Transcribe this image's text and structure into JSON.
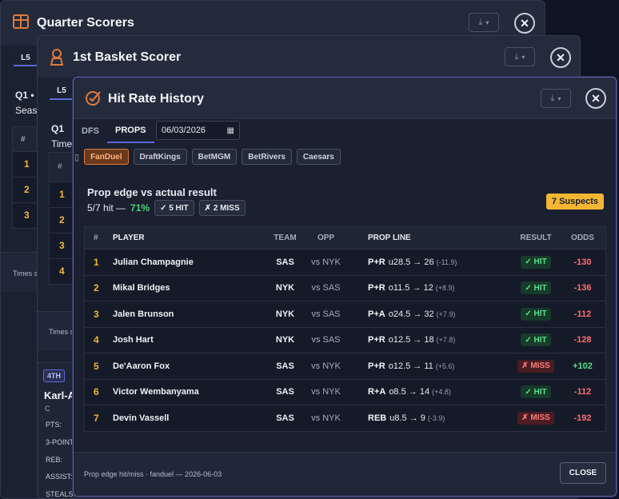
{
  "quarter_window": {
    "title": "Quarter Scorers",
    "tab": "L5",
    "heading": "Q1 •",
    "sub": "Seaso",
    "col_hash": "#",
    "rows": [
      "1",
      "2",
      "3"
    ],
    "footer": "Times s"
  },
  "basket_window": {
    "title": "1st Basket Scorer",
    "tab": "L5",
    "heading": "Q1",
    "sub": "Times",
    "col_hash": "#",
    "rows": [
      "1",
      "2",
      "3",
      "4"
    ],
    "footer": "Times s",
    "card_badge": "4TH",
    "card_name": "Karl-A",
    "card_pos": "C",
    "card_stats": [
      "PTS:",
      "3-POINT",
      "REB:",
      "ASSIST:",
      "STEALS:"
    ]
  },
  "dialog": {
    "title": "Hit Rate History",
    "tabs": [
      {
        "label": "DFS",
        "active": false
      },
      {
        "label": "PROPS",
        "active": true
      }
    ],
    "date_value": "06/03/2026",
    "books": [
      {
        "label": "FanDuel",
        "active": true
      },
      {
        "label": "DraftKings",
        "active": false
      },
      {
        "label": "BetMGM",
        "active": false
      },
      {
        "label": "BetRivers",
        "active": false
      },
      {
        "label": "Caesars",
        "active": false
      }
    ],
    "summary": {
      "title": "Prop edge vs actual result",
      "hit_text": "5/7 hit —",
      "pct": "71%",
      "hit_chip": "✓ 5 HIT",
      "miss_chip": "✗ 2 MISS",
      "suspects": "7 Suspects"
    },
    "columns": {
      "num": "#",
      "player": "PLAYER",
      "team": "TEAM",
      "opp": "OPP",
      "line": "PROP LINE",
      "result": "RESULT",
      "odds": "ODDS"
    },
    "rows": [
      {
        "num": "1",
        "player": "Julian Champagnie",
        "team": "SAS",
        "opp": "vs NYK",
        "type": "P+R",
        "line": "u28.5 → 26",
        "edge": "(-11.9)",
        "result": "✓ HIT",
        "hit": true,
        "odds": "-130",
        "odds_pos": false
      },
      {
        "num": "2",
        "player": "Mikal Bridges",
        "team": "NYK",
        "opp": "vs SAS",
        "type": "P+R",
        "line": "o11.5 → 12",
        "edge": "(+8.9)",
        "result": "✓ HIT",
        "hit": true,
        "odds": "-136",
        "odds_pos": false
      },
      {
        "num": "3",
        "player": "Jalen Brunson",
        "team": "NYK",
        "opp": "vs SAS",
        "type": "P+A",
        "line": "o24.5 → 32",
        "edge": "(+7.9)",
        "result": "✓ HIT",
        "hit": true,
        "odds": "-112",
        "odds_pos": false
      },
      {
        "num": "4",
        "player": "Josh Hart",
        "team": "NYK",
        "opp": "vs SAS",
        "type": "P+R",
        "line": "o12.5 → 18",
        "edge": "(+7.8)",
        "result": "✓ HIT",
        "hit": true,
        "odds": "-128",
        "odds_pos": false
      },
      {
        "num": "5",
        "player": "De'Aaron Fox",
        "team": "SAS",
        "opp": "vs NYK",
        "type": "P+R",
        "line": "o12.5 → 11",
        "edge": "(+5.6)",
        "result": "✗ MISS",
        "hit": false,
        "odds": "+102",
        "odds_pos": true
      },
      {
        "num": "6",
        "player": "Victor Wembanyama",
        "team": "SAS",
        "opp": "vs NYK",
        "type": "R+A",
        "line": "o8.5 → 14",
        "edge": "(+4.8)",
        "result": "✓ HIT",
        "hit": true,
        "odds": "-112",
        "odds_pos": false
      },
      {
        "num": "7",
        "player": "Devin Vassell",
        "team": "SAS",
        "opp": "vs NYK",
        "type": "REB",
        "line": "u8.5 → 9",
        "edge": "(-3.9)",
        "result": "✗ MISS",
        "hit": false,
        "odds": "-192",
        "odds_pos": false
      }
    ],
    "footer_text": "Prop edge hit/miss · fanduel — 2026-06-03",
    "close_label": "CLOSE"
  },
  "colors": {
    "accent_orange": "#e07a3a",
    "hit_green": "#56e08a",
    "miss_red": "#ff6e6e",
    "suspect_yellow": "#f2b632",
    "tab_indicator": "#5b6bd8"
  }
}
